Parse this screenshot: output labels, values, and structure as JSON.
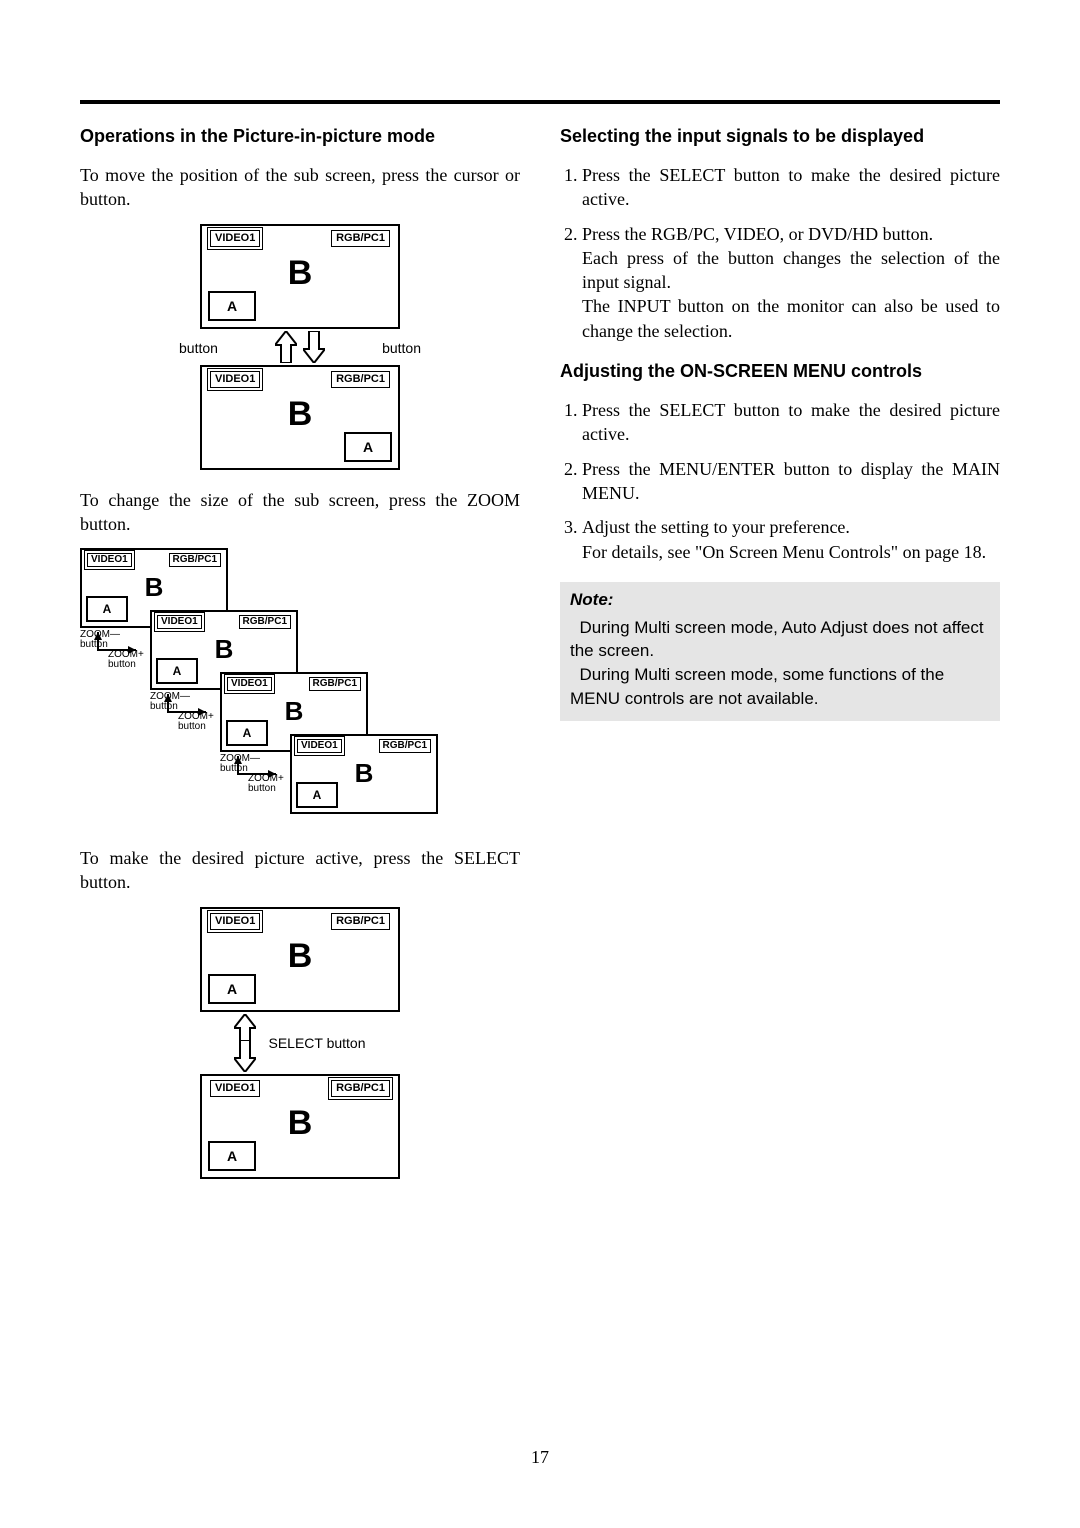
{
  "page_number": "17",
  "labels": {
    "video1": "VIDEO1",
    "rgbpc1": "RGB/PC1",
    "A": "A",
    "B": "B",
    "button": "button",
    "select_button": "SELECT  button",
    "zoom_minus": "ZOOM—",
    "zoom_plus": "ZOOM+"
  },
  "left": {
    "h_pip": "Operations in the Picture-in-picture mode",
    "p_move": "To move the position of the sub screen, press the cursor    or     button.",
    "p_zoom": "To change the size of the sub screen, press the ZOOM button.",
    "p_select": "To make the desired picture active, press the SELECT button."
  },
  "right": {
    "h_input": "Selecting the input signals to be displayed",
    "step_i1": "Press the SELECT button to make the desired picture active.",
    "step_i2a": "Press the RGB/PC, VIDEO, or DVD/HD button.",
    "step_i2b": "Each press of the button changes the selection of the input signal.",
    "step_i2c": "The INPUT  button on the monitor can also be used to change the selection.",
    "h_osd": "Adjusting the ON-SCREEN MENU controls",
    "step_o1": "Press the SELECT button to make the desired picture active.",
    "step_o2": "Press the MENU/ENTER button to display the MAIN MENU.",
    "step_o3a": "Adjust the setting to your preference.",
    "step_o3b": "For details, see \"On Screen Menu Controls\" on page 18.",
    "note_title": "Note:",
    "note_1": "During Multi screen mode, Auto Adjust does not affect the screen.",
    "note_2": "During Multi screen mode, some functions of the MENU controls are not available."
  }
}
